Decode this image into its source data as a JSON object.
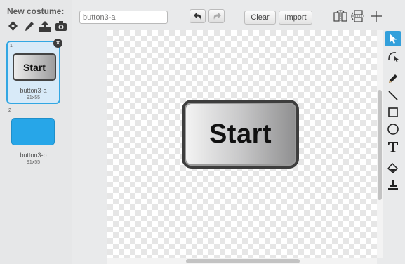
{
  "new_costume": {
    "label": "New costume:",
    "tools": [
      "paint-brush-icon",
      "pencil-icon",
      "upload-icon",
      "camera-icon"
    ]
  },
  "costumes": [
    {
      "number": "1",
      "name": "button3-a",
      "size": "91x55",
      "thumb_text": "Start",
      "selected": true
    },
    {
      "number": "2",
      "name": "button3-b",
      "size": "91x55",
      "thumb_color": "#27a6e8",
      "selected": false
    }
  ],
  "toolbar": {
    "name_value": "button3-a",
    "undo": "undo-icon",
    "redo": "redo-icon",
    "clear_label": "Clear",
    "import_label": "Import",
    "flip_h": "flip-horizontal-icon",
    "flip_v": "flip-vertical-icon",
    "set_center": "set-center-icon"
  },
  "canvas": {
    "button_text": "Start"
  },
  "tools": [
    "select-icon",
    "reshape-icon",
    "pencil-icon",
    "line-icon",
    "rectangle-icon",
    "ellipse-icon",
    "text-icon",
    "fill-icon",
    "stamp-icon"
  ],
  "colors": {
    "accent": "#33a0db",
    "selected_border": "#32a7e3",
    "costume_blue": "#27a6e8"
  }
}
